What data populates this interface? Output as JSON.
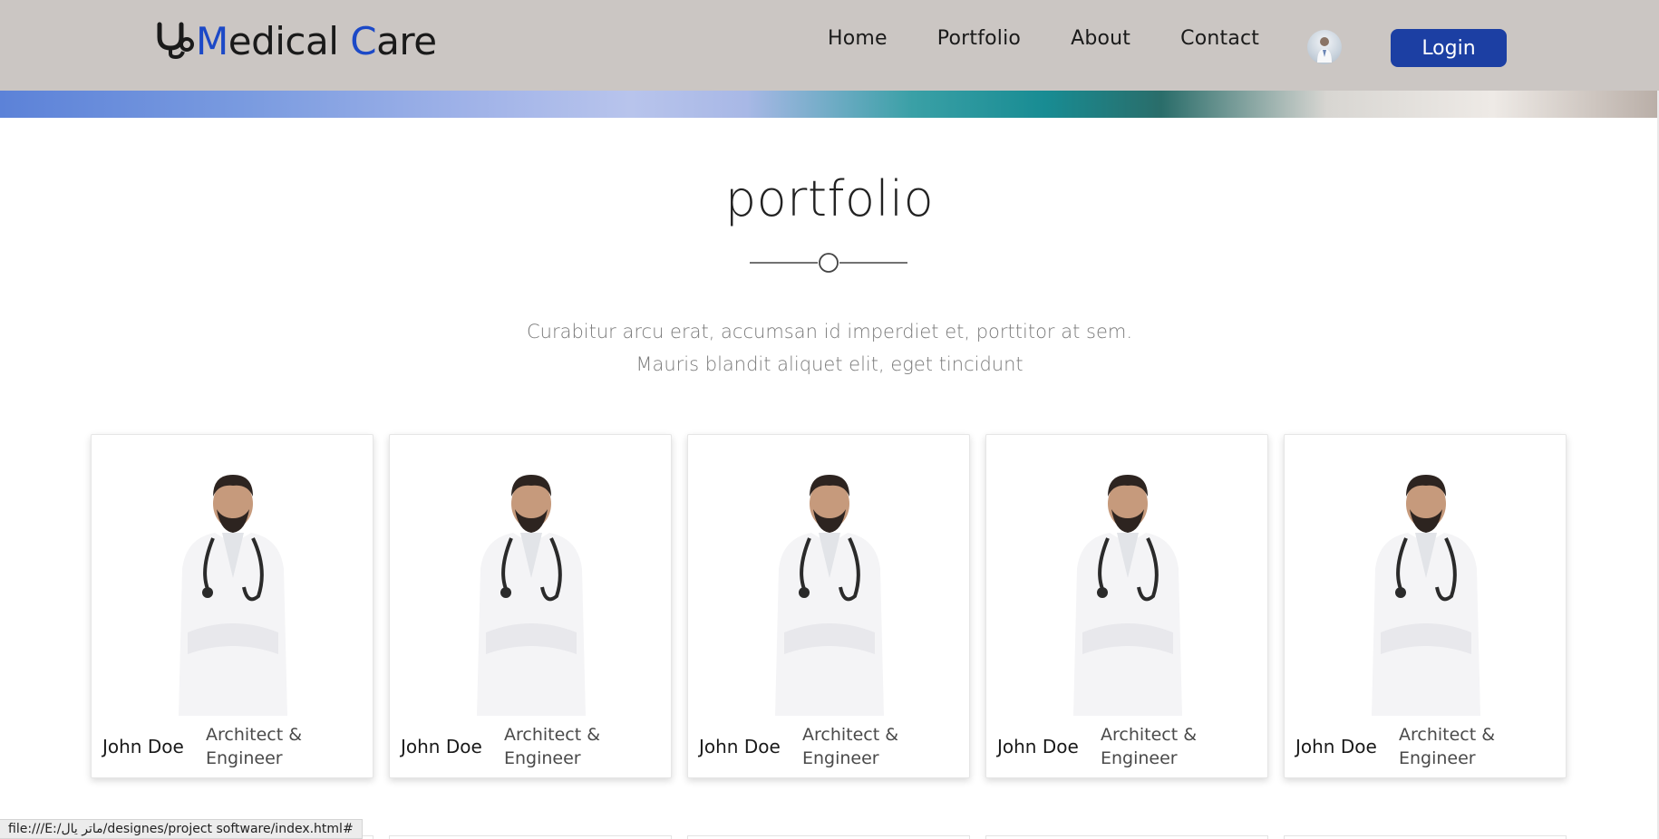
{
  "header": {
    "logo_prefix": "",
    "logo_word1_accent": "M",
    "logo_word1_rest": "edical ",
    "logo_word2_accent": "C",
    "logo_word2_rest": "are",
    "nav": [
      "Home",
      "Portfolio",
      "About",
      "Contact"
    ],
    "login_label": "Login",
    "brand_color": "#1c49c7",
    "login_color": "#1c3fa3",
    "header_bg": "#cbc6c3"
  },
  "section": {
    "title": "portfolio",
    "subtitle_line1": "Curabitur arcu erat, accumsan id imperdiet et, porttitor at sem.",
    "subtitle_line2": "Mauris blandit aliquet elit, eget tincidunt"
  },
  "cards": [
    {
      "name": "John Doe",
      "role": "Architect & Engineer"
    },
    {
      "name": "John Doe",
      "role": "Architect & Engineer"
    },
    {
      "name": "John Doe",
      "role": "Architect & Engineer"
    },
    {
      "name": "John Doe",
      "role": "Architect & Engineer"
    },
    {
      "name": "John Doe",
      "role": "Architect & Engineer"
    }
  ],
  "status_bar": {
    "url": "file:///E:/ماتر يال/designes/project software/index.html#"
  },
  "icons": {
    "logo": "stethoscope-icon",
    "avatar": "doctor-avatar",
    "divider": "circle-divider-icon",
    "card_photo": "doctor-photo"
  }
}
